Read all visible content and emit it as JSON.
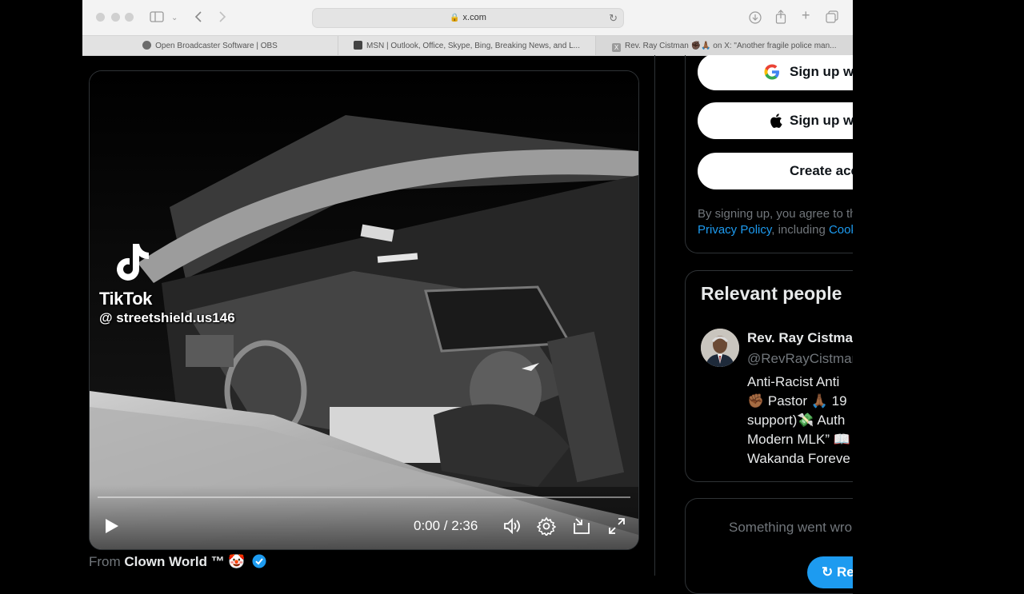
{
  "browser": {
    "url": "x.com",
    "tabs": [
      {
        "label": "Open Broadcaster Software | OBS",
        "favicon": "obs-icon"
      },
      {
        "label": "MSN | Outlook, Office, Skype, Bing, Breaking News, and L...",
        "favicon": "msn-icon"
      },
      {
        "label": "Rev. Ray Cistman ✊🏿🙏🏾 on X: \"Another fragile police man...",
        "favicon": "x-icon"
      }
    ]
  },
  "video": {
    "watermark_brand": "TikTok",
    "watermark_handle": "@ streetshield.us146",
    "time_display": "0:00 / 2:36",
    "progress": 0.0
  },
  "attribution": {
    "prefix": "From",
    "name": "Clown World ™ 🤡"
  },
  "signup": {
    "google_label": "Sign up with Google",
    "apple_label": "Sign up with Apple",
    "create_label": "Create account",
    "terms_prefix": "By signing up, you agree to the Terms of Service and",
    "privacy_link": "Privacy Policy",
    "terms_middle": ", including",
    "cookie_link": "Cookie Use."
  },
  "relevant_people": {
    "title": "Relevant people",
    "person": {
      "name": "Rev. Ray Cistman",
      "handle": "@RevRayCistman",
      "bio_lines": [
        "Anti-Racist Anti",
        "✊🏾 Pastor 🙏🏾 19",
        "support)💸 Auth",
        "Modern MLK” 📖",
        "Wakanda Foreve"
      ]
    }
  },
  "error": {
    "message": "Something went wrong. Try reloading.",
    "retry_label": "Retry"
  },
  "colors": {
    "accent": "#1d9bf0",
    "background": "#000000",
    "border": "#2f3336",
    "muted_text": "#71767b"
  }
}
